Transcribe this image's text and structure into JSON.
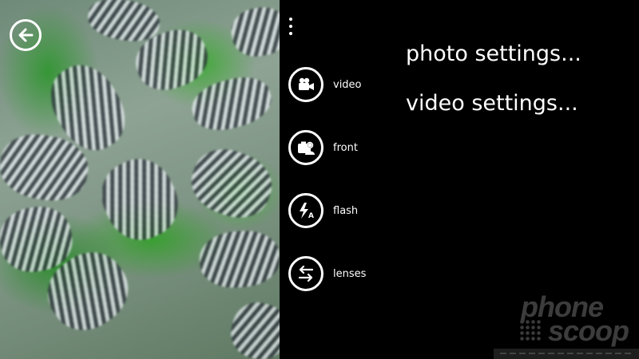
{
  "viewfinder": {
    "back_icon": "arrow-left-icon"
  },
  "menu": {
    "more_icon": "more-dots-icon",
    "items": [
      {
        "label": "video",
        "icon": "video-camera-icon"
      },
      {
        "label": "front",
        "icon": "front-camera-icon"
      },
      {
        "label": "flash",
        "icon": "flash-auto-icon"
      },
      {
        "label": "lenses",
        "icon": "swap-arrows-icon"
      }
    ]
  },
  "settings": {
    "photo": "photo settings...",
    "video": "video settings..."
  },
  "watermark": {
    "line1": "phone",
    "line2": "scoop"
  },
  "colors": {
    "background": "#000000",
    "foreground": "#ffffff"
  }
}
